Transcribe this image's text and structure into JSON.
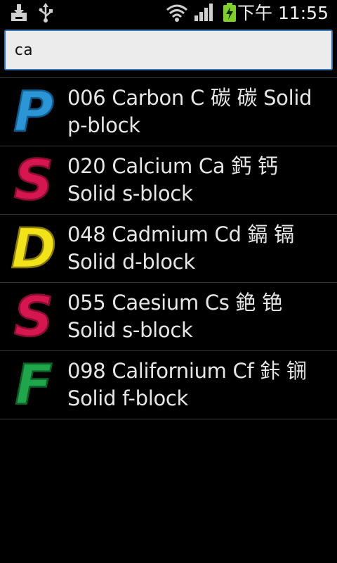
{
  "status_bar": {
    "time": "下午 11:55",
    "icons": [
      "download-icon",
      "usb-icon",
      "wifi-icon",
      "signal-icon",
      "battery-charging-icon"
    ],
    "battery_color": "#7fd12a"
  },
  "search": {
    "value": "ca"
  },
  "results": [
    {
      "badge": "P",
      "badge_color": "#2b95d6",
      "line": "006 Carbon C 碳 碳 Solid p-block"
    },
    {
      "badge": "S",
      "badge_color": "#d6174f",
      "line": "020 Calcium Ca 鈣 钙 Solid s-block"
    },
    {
      "badge": "D",
      "badge_color": "#f2e21a",
      "line": "048 Cadmium Cd 鎘 镉 Solid d-block"
    },
    {
      "badge": "S",
      "badge_color": "#d6174f",
      "line": "055 Caesium Cs 銫 铯 Solid s-block"
    },
    {
      "badge": "F",
      "badge_color": "#1fa54a",
      "line": "098 Californium Cf 鉲 锎 Solid f-block"
    }
  ]
}
